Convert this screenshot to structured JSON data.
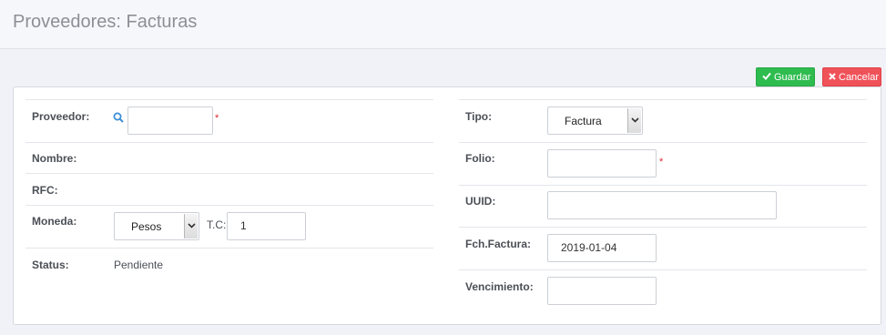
{
  "header": {
    "title": "Proveedores: Facturas"
  },
  "toolbar": {
    "save_label": "Guardar",
    "cancel_label": "Cancelar"
  },
  "left": {
    "proveedor": {
      "label": "Proveedor:",
      "value": "",
      "required": "*"
    },
    "nombre": {
      "label": "Nombre:"
    },
    "rfc": {
      "label": "RFC:"
    },
    "moneda": {
      "label": "Moneda:",
      "selected": "Pesos",
      "tc_label": "T.C:",
      "tc_value": "1"
    },
    "status": {
      "label": "Status:",
      "value": "Pendiente"
    }
  },
  "right": {
    "tipo": {
      "label": "Tipo:",
      "selected": "Factura"
    },
    "folio": {
      "label": "Folio:",
      "value": "",
      "required": "*"
    },
    "uuid": {
      "label": "UUID:",
      "value": ""
    },
    "fecha": {
      "label": "Fch.Factura:",
      "value": "2019-01-04"
    },
    "vencimiento": {
      "label": "Vencimiento:",
      "value": ""
    }
  },
  "colors": {
    "save": "#2ebc4f",
    "cancel": "#f0525a",
    "required": "#e0262b",
    "search": "#3d8fd8"
  }
}
